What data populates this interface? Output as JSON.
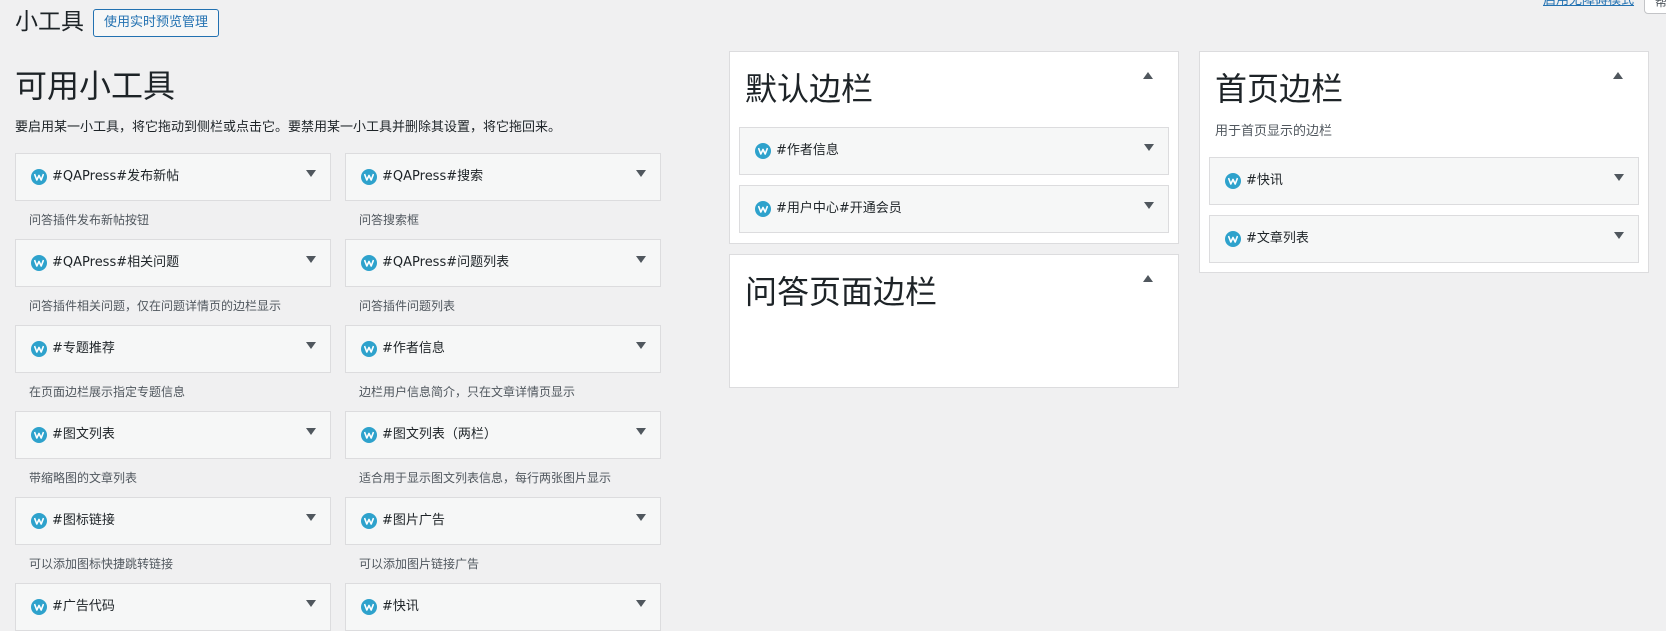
{
  "header": {
    "title": "小工具",
    "live_preview_button": "使用实时预览管理",
    "accessibility_link": "启用无障碍模式",
    "help_tab": "帮"
  },
  "available": {
    "title": "可用小工具",
    "description": "要启用某一小工具，将它拖动到侧栏或点击它。要禁用某一小工具并删除其设置，将它拖回来。",
    "widgets": [
      {
        "label": "#QAPress#发布新帖",
        "description": "问答插件发布新帖按钮"
      },
      {
        "label": "#QAPress#搜索",
        "description": "问答搜索框"
      },
      {
        "label": "#QAPress#相关问题",
        "description": "问答插件相关问题，仅在问题详情页的边栏显示"
      },
      {
        "label": "#QAPress#问题列表",
        "description": "问答插件问题列表"
      },
      {
        "label": "#专题推荐",
        "description": "在页面边栏展示指定专题信息"
      },
      {
        "label": "#作者信息",
        "description": "边栏用户信息简介，只在文章详情页显示"
      },
      {
        "label": "#图文列表",
        "description": "带缩略图的文章列表"
      },
      {
        "label": "#图文列表（两栏）",
        "description": "适合用于显示图文列表信息，每行两张图片显示"
      },
      {
        "label": "#图标链接",
        "description": "可以添加图标快捷跳转链接"
      },
      {
        "label": "#图片广告",
        "description": "可以添加图片链接广告"
      },
      {
        "label": "#广告代码",
        "description": ""
      },
      {
        "label": "#快讯",
        "description": ""
      }
    ]
  },
  "sidebars": {
    "default": {
      "title": "默认边栏",
      "widgets": [
        {
          "label": "#作者信息"
        },
        {
          "label": "#用户中心#开通会员"
        }
      ]
    },
    "qa_page": {
      "title": "问答页面边栏",
      "widgets": []
    },
    "home": {
      "title": "首页边栏",
      "description": "用于首页显示的边栏",
      "widgets": [
        {
          "label": "#快讯"
        },
        {
          "label": "#文章列表"
        }
      ]
    }
  },
  "colors": {
    "accent": "#2271b1",
    "icon": "#2ea2cc",
    "background": "#f0f0f1"
  }
}
